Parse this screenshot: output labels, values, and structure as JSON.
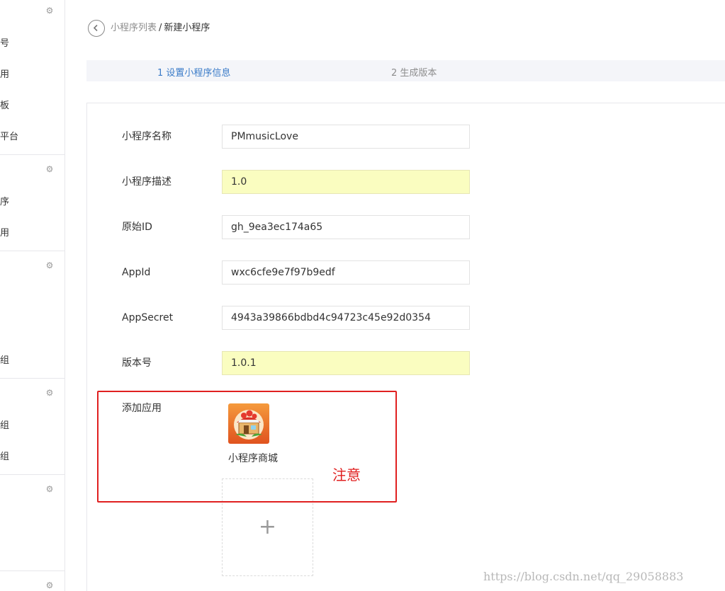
{
  "sidebar": {
    "items": [
      "号",
      "用",
      "板",
      "平台",
      "序",
      "用",
      "组",
      "组",
      "组"
    ],
    "gear_icon": "gear-icon"
  },
  "breadcrumb": {
    "parent": "小程序列表",
    "separator": "/",
    "current": "新建小程序"
  },
  "steps": [
    "1 设置小程序信息",
    "2 生成版本"
  ],
  "form": {
    "fields": [
      {
        "label": "小程序名称",
        "value": "PMmusicLove",
        "highlight": false
      },
      {
        "label": "小程序描述",
        "value": "1.0",
        "highlight": true
      },
      {
        "label": "原始ID",
        "value": "gh_9ea3ec174a65",
        "highlight": false
      },
      {
        "label": "AppId",
        "value": "wxc6cfe9e7f97b9edf",
        "highlight": false
      },
      {
        "label": "AppSecret",
        "value": "4943a39866bdbd4c94723c45e92d0354",
        "highlight": false
      },
      {
        "label": "版本号",
        "value": "1.0.1",
        "highlight": true
      }
    ],
    "add_app": {
      "label": "添加应用",
      "app_name": "小程序商城",
      "add_symbol": "+"
    }
  },
  "annotation": {
    "note": "注意",
    "color": "#e02020"
  },
  "watermark": "https://blog.csdn.net/qq_29058883",
  "colors": {
    "accent": "#3a7bc8",
    "highlight_input": "#fafdc0"
  }
}
